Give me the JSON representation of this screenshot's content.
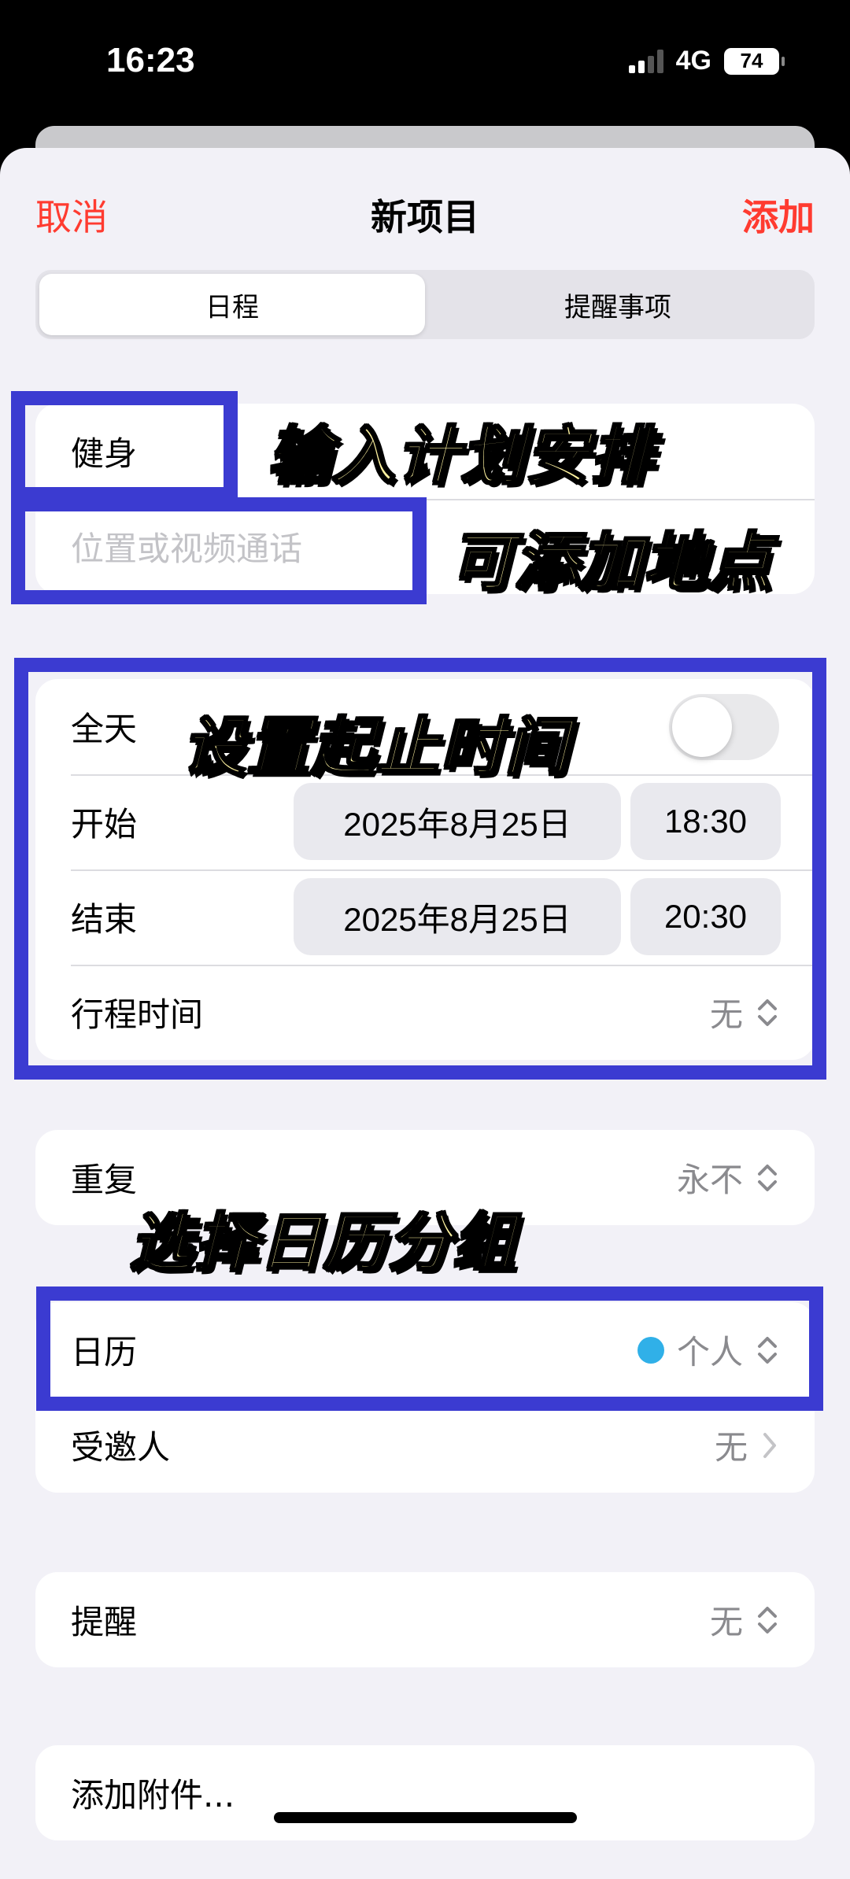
{
  "status_bar": {
    "time": "16:23",
    "network": "4G",
    "battery": "74"
  },
  "nav": {
    "cancel": "取消",
    "title": "新项目",
    "add": "添加"
  },
  "segments": [
    "日程",
    "提醒事项"
  ],
  "title_field": {
    "value": "健身"
  },
  "location_field": {
    "placeholder": "位置或视频通话"
  },
  "all_day": {
    "label": "全天",
    "on": false
  },
  "start": {
    "label": "开始",
    "date": "2025年8月25日",
    "time": "18:30"
  },
  "end": {
    "label": "结束",
    "date": "2025年8月25日",
    "time": "20:30"
  },
  "travel_time": {
    "label": "行程时间",
    "value": "无"
  },
  "repeat": {
    "label": "重复",
    "value": "永不"
  },
  "calendar": {
    "label": "日历",
    "value": "个人",
    "dot_color": "#30b0e8"
  },
  "invitees": {
    "label": "受邀人",
    "value": "无"
  },
  "alert": {
    "label": "提醒",
    "value": "无"
  },
  "attachment": {
    "label": "添加附件..."
  },
  "annotations": {
    "title_hint": "输入计划安排",
    "location_hint": "可添加地点",
    "time_hint": "设置起止时间",
    "calendar_hint": "选择日历分组"
  },
  "colors": {
    "accent": "#ff3b30",
    "annotation_border": "#3b3bd1",
    "annotation_text": "#fff3a0"
  }
}
